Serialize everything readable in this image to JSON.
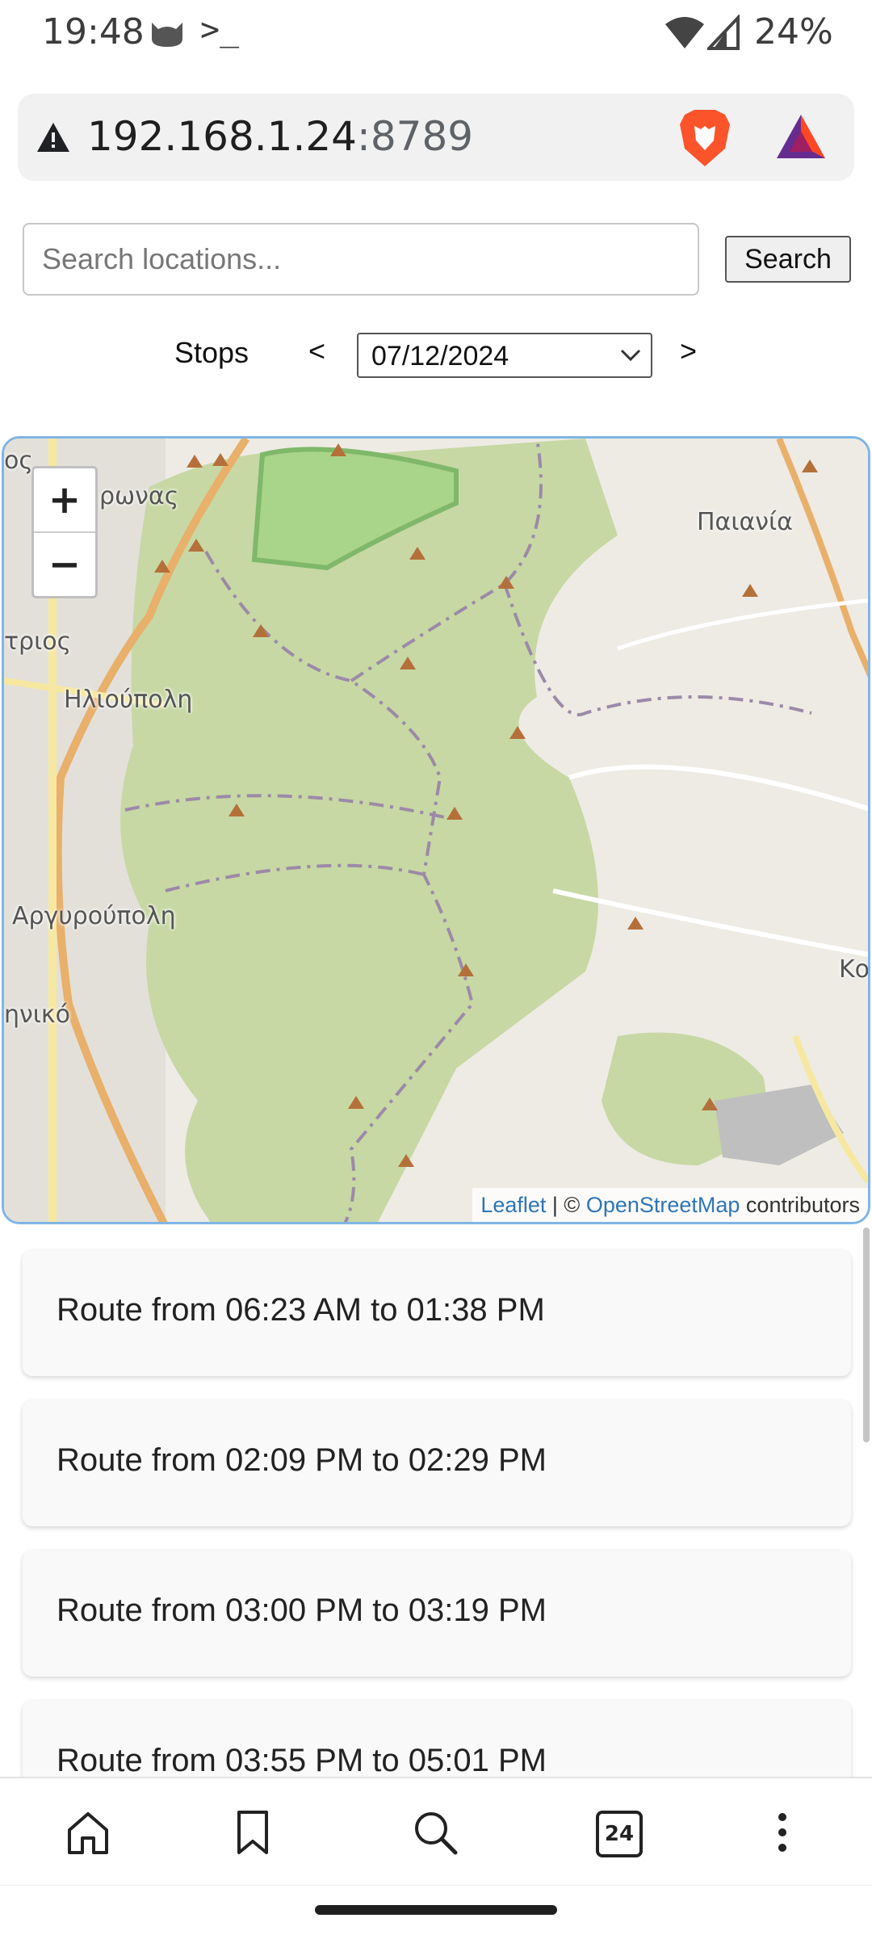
{
  "status": {
    "time": "19:48",
    "terminal": ">_",
    "battery": "24%"
  },
  "browser": {
    "url_host": "192.168.1.24",
    "url_port": ":8789"
  },
  "search": {
    "placeholder": "Search locations...",
    "value": "",
    "button_label": "Search"
  },
  "stops": {
    "label": "Stops",
    "prev": "<",
    "next": ">",
    "date": "07/12/2024"
  },
  "map": {
    "zoom_in": "+",
    "zoom_out": "−",
    "labels": [
      "Παιανία",
      "Ηλιούπολη",
      "Αργυρούπολη",
      "ρωνας",
      "τριος",
      "ηνικό",
      "Κο",
      "ος"
    ],
    "attribution": {
      "leaflet": "Leaflet",
      "sep": " | © ",
      "osm": "OpenStreetMap",
      "suffix": " contributors"
    }
  },
  "routes": [
    "Route from 06:23 AM to 01:38 PM",
    "Route from 02:09 PM to 02:29 PM",
    "Route from 03:00 PM to 03:19 PM",
    "Route from 03:55 PM to 05:01 PM"
  ],
  "nav": {
    "tab_count": "24",
    "icons": [
      "home-icon",
      "bookmark-icon",
      "search-icon",
      "tabs-icon",
      "more-icon"
    ]
  }
}
